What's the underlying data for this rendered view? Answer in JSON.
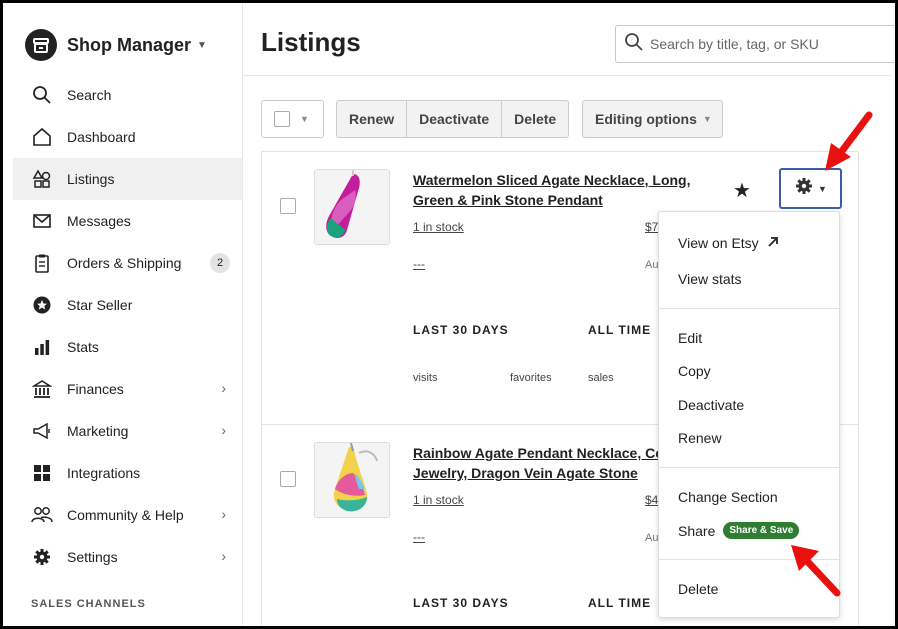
{
  "brand": {
    "title": "Shop Manager"
  },
  "sidebar": {
    "items": [
      {
        "label": "Search",
        "icon": "search-icon"
      },
      {
        "label": "Dashboard",
        "icon": "home-icon"
      },
      {
        "label": "Listings",
        "icon": "shapes-icon",
        "active": true
      },
      {
        "label": "Messages",
        "icon": "envelope-icon"
      },
      {
        "label": "Orders & Shipping",
        "icon": "clipboard-icon",
        "badge": "2"
      },
      {
        "label": "Star Seller",
        "icon": "star-badge-icon"
      },
      {
        "label": "Stats",
        "icon": "bar-chart-icon"
      },
      {
        "label": "Finances",
        "icon": "bank-icon",
        "chevron": true
      },
      {
        "label": "Marketing",
        "icon": "megaphone-icon",
        "chevron": true
      },
      {
        "label": "Integrations",
        "icon": "grid-icon"
      },
      {
        "label": "Community & Help",
        "icon": "people-icon",
        "chevron": true
      },
      {
        "label": "Settings",
        "icon": "gear-icon",
        "chevron": true
      }
    ],
    "section_label": "SALES CHANNELS"
  },
  "header": {
    "title": "Listings",
    "search_placeholder": "Search by title, tag, or SKU"
  },
  "toolbar": {
    "renew": "Renew",
    "deactivate": "Deactivate",
    "delete": "Delete",
    "editing_options": "Editing options"
  },
  "listings": [
    {
      "title_line1": "Watermelon Sliced Agate Necklace, Long,",
      "title_line2": "Green & Pink Stone Pendant",
      "stock": "1 in stock",
      "price": "$7",
      "dash": "---",
      "auto": "Au",
      "last30": "LAST 30 DAYS",
      "alltime": "ALL TIME",
      "visits": "visits",
      "favorites": "favorites",
      "sales": "sales"
    },
    {
      "title_line1": "Rainbow Agate Pendant Necklace, Co",
      "title_line2": "Jewelry, Dragon Vein Agate Stone",
      "stock": "1 in stock",
      "price": "$4",
      "dash": "---",
      "auto": "Au",
      "last30": "LAST 30 DAYS",
      "alltime": "ALL TIME"
    }
  ],
  "menu": {
    "view_on_etsy": "View on Etsy",
    "view_stats": "View stats",
    "edit": "Edit",
    "copy": "Copy",
    "deactivate": "Deactivate",
    "renew": "Renew",
    "change_section": "Change Section",
    "share": "Share",
    "share_badge": "Share & Save",
    "delete": "Delete"
  },
  "colors": {
    "accent_blue": "#3a5ea8",
    "badge_green": "#2e7d32",
    "annotation_red": "#e8110f"
  }
}
